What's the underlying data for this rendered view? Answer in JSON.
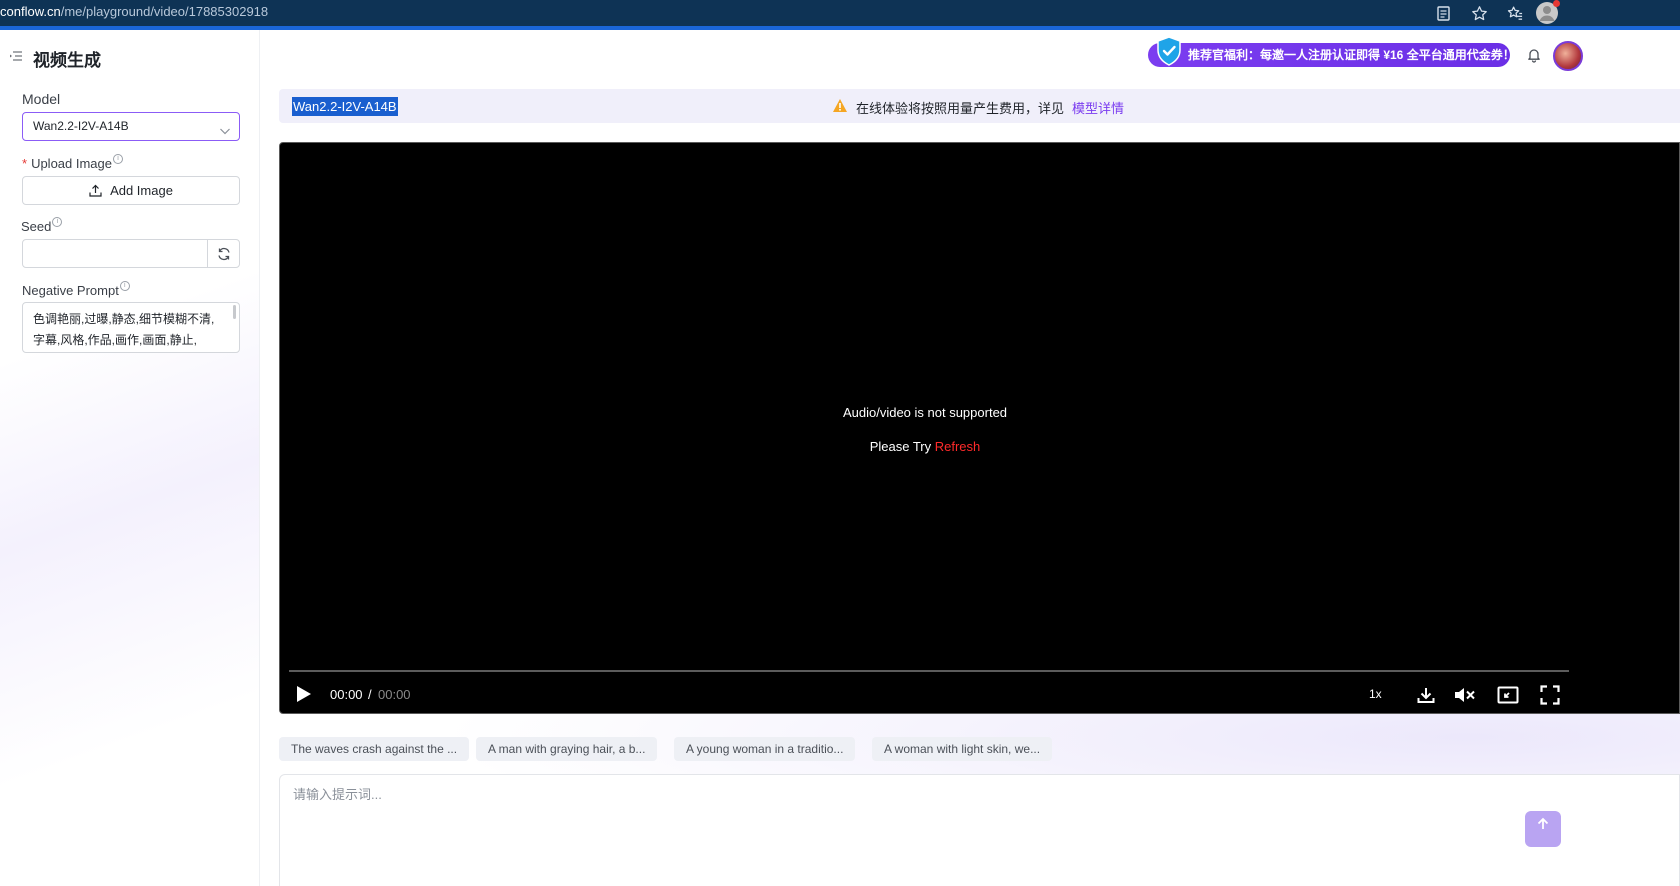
{
  "browser": {
    "url_host": "conflow.cn",
    "url_path": "/me/playground/video/17885302918",
    "icons": [
      "reader-mode-icon",
      "star-icon",
      "favorites-icon",
      "profile-icon"
    ]
  },
  "header": {
    "title": "视频生成",
    "promo_text": "推荐官福利：每邀一人注册认证即得 ¥16 全平台通用代金券！"
  },
  "form": {
    "model_label": "Model",
    "model_value": "Wan2.2-I2V-A14B",
    "upload_label": "Upload Image",
    "upload_required": "*",
    "upload_button": "Add Image",
    "seed_label": "Seed",
    "seed_value": "",
    "negative_label": "Negative Prompt",
    "negative_value": "色调艳丽,过曝,静态,细节模糊不清,字幕,风格,作品,画作,画面,静止,"
  },
  "notice": {
    "model_name": "Wan2.2-I2V-A14B",
    "text": "在线体验将按照用量产生费用，详见",
    "link": "模型详情"
  },
  "video": {
    "message": "Audio/video is not supported",
    "try_text": "Please Try",
    "refresh": "Refresh",
    "current_time": "00:00",
    "separator": "/",
    "total_time": "00:00",
    "speed": "1x",
    "progress": 0
  },
  "suggestions": [
    "The waves crash against the ...",
    "A man with graying hair, a b...",
    "A young woman in a traditio...",
    "A woman with light skin, we..."
  ],
  "prompt": {
    "placeholder": "请输入提示词..."
  },
  "colors": {
    "accent": "#7b3df0",
    "browser_bar": "#0e3355",
    "warning": "#f5a623",
    "refresh": "#ff2a2a"
  }
}
